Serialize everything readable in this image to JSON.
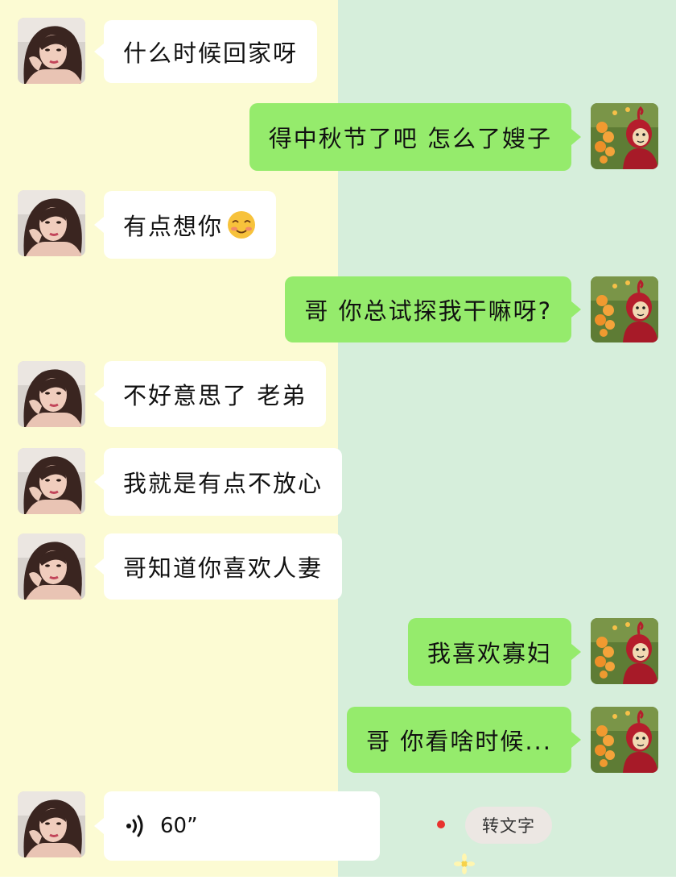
{
  "colors": {
    "left_background": "#fcfbd3",
    "right_background": "#d6eedb",
    "incoming_bubble": "#ffffff",
    "outgoing_bubble": "#95eb6c",
    "unread_dot": "#e8332e"
  },
  "messages": [
    {
      "side": "in",
      "text": "什么时候回家呀"
    },
    {
      "side": "out",
      "text": "得中秋节了吧 怎么了嫂子"
    },
    {
      "side": "in",
      "text": "有点想你",
      "emoji": "smiling-blushing-emoji-icon"
    },
    {
      "side": "out",
      "text": "哥 你总试探我干嘛呀?"
    },
    {
      "side": "in",
      "text": "不好意思了 老弟"
    },
    {
      "side": "in",
      "text": "我就是有点不放心"
    },
    {
      "side": "in",
      "text": "哥知道你喜欢人妻"
    },
    {
      "side": "out",
      "text": "我喜欢寡妇"
    },
    {
      "side": "out",
      "text": "哥 你看啥时候..."
    }
  ],
  "voice_message": {
    "icon": "voice-wave-icon",
    "duration": "60”",
    "convert_button": "转文字"
  }
}
